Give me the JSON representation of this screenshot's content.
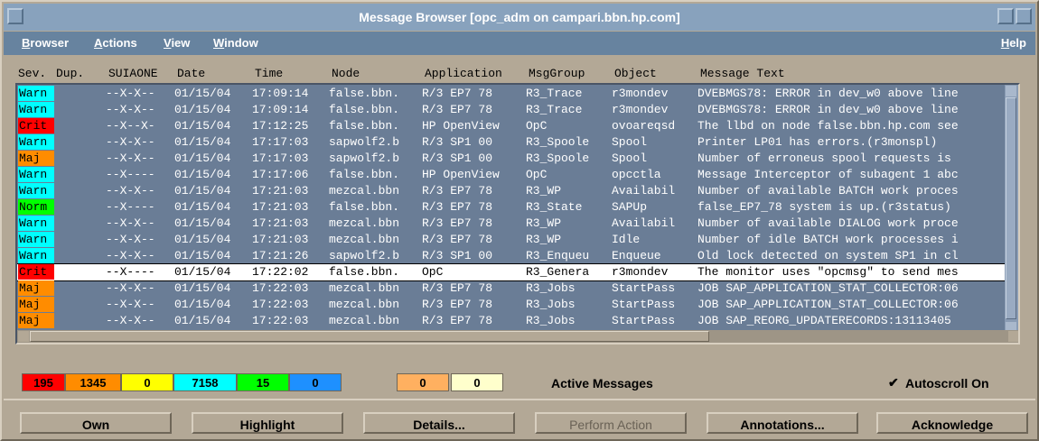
{
  "window": {
    "title": "Message Browser  [opc_adm on campari.bbn.hp.com]"
  },
  "menu": {
    "items": [
      "Browser",
      "Actions",
      "View",
      "Window"
    ],
    "help": "Help"
  },
  "columns": [
    "Sev.",
    "Dup.",
    "SUIAONE",
    "Date",
    "Time",
    "Node",
    "Application",
    "MsgGroup",
    "Object",
    "Message Text"
  ],
  "severity_colors": {
    "Warn": "#00ffff",
    "Crit": "#ff0000",
    "Maj": "#ff8c00",
    "Norm": "#00ff00"
  },
  "messages": [
    {
      "sev": "Warn",
      "flags": "--X-X--",
      "date": "01/15/04",
      "time": "17:09:14",
      "node": "false.bbn.",
      "app": "R/3 EP7 78",
      "group": "R3_Trace",
      "object": "r3mondev",
      "text": "DVEBMGS78: ERROR in dev_w0 above line"
    },
    {
      "sev": "Warn",
      "flags": "--X-X--",
      "date": "01/15/04",
      "time": "17:09:14",
      "node": "false.bbn.",
      "app": "R/3 EP7 78",
      "group": "R3_Trace",
      "object": "r3mondev",
      "text": "DVEBMGS78: ERROR in dev_w0 above line"
    },
    {
      "sev": "Crit",
      "flags": "--X--X-",
      "date": "01/15/04",
      "time": "17:12:25",
      "node": "false.bbn.",
      "app": "HP OpenView",
      "group": "OpC",
      "object": "ovoareqsd",
      "text": "The llbd on node false.bbn.hp.com see"
    },
    {
      "sev": "Warn",
      "flags": "--X-X--",
      "date": "01/15/04",
      "time": "17:17:03",
      "node": "sapwolf2.b",
      "app": "R/3 SP1 00",
      "group": "R3_Spoole",
      "object": "Spool",
      "text": "Printer LP01 has errors.(r3monspl)"
    },
    {
      "sev": "Maj",
      "flags": "--X-X--",
      "date": "01/15/04",
      "time": "17:17:03",
      "node": "sapwolf2.b",
      "app": "R/3 SP1 00",
      "group": "R3_Spoole",
      "object": "Spool",
      "text": "Number of erroneus spool requests is"
    },
    {
      "sev": "Warn",
      "flags": "--X----",
      "date": "01/15/04",
      "time": "17:17:06",
      "node": "false.bbn.",
      "app": "HP OpenView",
      "group": "OpC",
      "object": "opcctla",
      "text": "Message Interceptor of subagent 1 abc"
    },
    {
      "sev": "Warn",
      "flags": "--X-X--",
      "date": "01/15/04",
      "time": "17:21:03",
      "node": "mezcal.bbn",
      "app": "R/3 EP7 78",
      "group": "R3_WP",
      "object": "Availabil",
      "text": "Number of available BATCH work proces"
    },
    {
      "sev": "Norm",
      "flags": "--X----",
      "date": "01/15/04",
      "time": "17:21:03",
      "node": "false.bbn.",
      "app": "R/3 EP7 78",
      "group": "R3_State",
      "object": "SAPUp",
      "text": "false_EP7_78 system is up.(r3status)"
    },
    {
      "sev": "Warn",
      "flags": "--X-X--",
      "date": "01/15/04",
      "time": "17:21:03",
      "node": "mezcal.bbn",
      "app": "R/3 EP7 78",
      "group": "R3_WP",
      "object": "Availabil",
      "text": "Number of available DIALOG work proce"
    },
    {
      "sev": "Warn",
      "flags": "--X-X--",
      "date": "01/15/04",
      "time": "17:21:03",
      "node": "mezcal.bbn",
      "app": "R/3 EP7 78",
      "group": "R3_WP",
      "object": "Idle",
      "text": "Number of idle BATCH work processes i"
    },
    {
      "sev": "Warn",
      "flags": "--X-X--",
      "date": "01/15/04",
      "time": "17:21:26",
      "node": "sapwolf2.b",
      "app": "R/3 SP1 00",
      "group": "R3_Enqueu",
      "object": "Enqueue",
      "text": "Old lock detected on system SP1 in cl"
    },
    {
      "sev": "Crit",
      "flags": "--X----",
      "date": "01/15/04",
      "time": "17:22:02",
      "node": "false.bbn.",
      "app": "OpC",
      "group": "R3_Genera",
      "object": "r3mondev",
      "text": "The monitor uses \"opcmsg\" to send mes",
      "selected": true
    },
    {
      "sev": "Maj",
      "flags": "--X-X--",
      "date": "01/15/04",
      "time": "17:22:03",
      "node": "mezcal.bbn",
      "app": "R/3 EP7 78",
      "group": "R3_Jobs",
      "object": "StartPass",
      "text": "JOB SAP_APPLICATION_STAT_COLLECTOR:06"
    },
    {
      "sev": "Maj",
      "flags": "--X-X--",
      "date": "01/15/04",
      "time": "17:22:03",
      "node": "mezcal.bbn",
      "app": "R/3 EP7 78",
      "group": "R3_Jobs",
      "object": "StartPass",
      "text": "JOB SAP_APPLICATION_STAT_COLLECTOR:06"
    },
    {
      "sev": "Maj",
      "flags": "--X-X--",
      "date": "01/15/04",
      "time": "17:22:03",
      "node": "mezcal.bbn",
      "app": "R/3 EP7 78",
      "group": "R3_Jobs",
      "object": "StartPass",
      "text": "JOB SAP_REORG_UPDATERECORDS:13113405"
    }
  ],
  "counts": [
    {
      "value": "195",
      "color": "#ff0000"
    },
    {
      "value": "1345",
      "color": "#ff8c00"
    },
    {
      "value": "0",
      "color": "#ffff00"
    },
    {
      "value": "7158",
      "color": "#00ffff"
    },
    {
      "value": "15",
      "color": "#00ff00"
    },
    {
      "value": "0",
      "color": "#1e90ff"
    }
  ],
  "extra_counts": [
    {
      "value": "0",
      "color": "#ffb060"
    },
    {
      "value": "0",
      "color": "#ffffcc"
    }
  ],
  "status": {
    "active_label": "Active Messages",
    "autoscroll_label": "Autoscroll On",
    "autoscroll_checked": true
  },
  "buttons": [
    "Own",
    "Highlight",
    "Details...",
    "Perform Action",
    "Annotations...",
    "Acknowledge"
  ],
  "disabled_buttons": [
    "Perform Action"
  ]
}
